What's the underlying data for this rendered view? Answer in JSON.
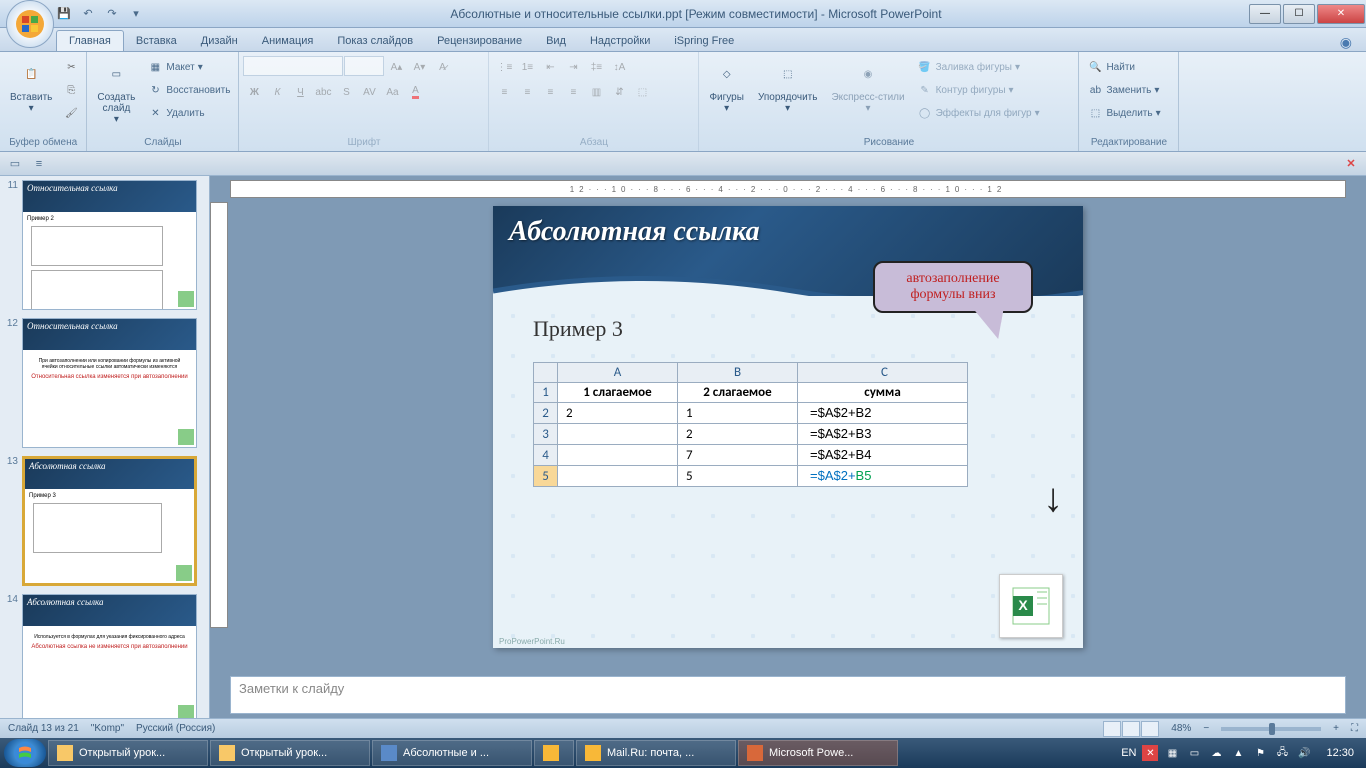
{
  "title": "Абсолютные и относительные ссылки.ppt [Режим совместимости] - Microsoft PowerPoint",
  "tabs": [
    "Главная",
    "Вставка",
    "Дизайн",
    "Анимация",
    "Показ слайдов",
    "Рецензирование",
    "Вид",
    "Надстройки",
    "iSpring Free"
  ],
  "ribbon": {
    "clipboard": {
      "label": "Буфер обмена",
      "paste": "Вставить"
    },
    "slides": {
      "label": "Слайды",
      "new": "Создать\nслайд",
      "layout": "Макет",
      "reset": "Восстановить",
      "delete": "Удалить"
    },
    "font": {
      "label": "Шрифт"
    },
    "paragraph": {
      "label": "Абзац"
    },
    "drawing": {
      "label": "Рисование",
      "shapes": "Фигуры",
      "arrange": "Упорядочить",
      "styles": "Экспресс-стили",
      "fill": "Заливка фигуры",
      "outline": "Контур фигуры",
      "effects": "Эффекты для фигур"
    },
    "editing": {
      "label": "Редактирование",
      "find": "Найти",
      "replace": "Заменить",
      "select": "Выделить"
    }
  },
  "ruler_text": "12···10···8···6···4···2···0···2···4···6···8···10···12",
  "thumbs": [
    {
      "num": "11",
      "title": "Относительная ссылка",
      "sub": "Пример 2"
    },
    {
      "num": "12",
      "title": "Относительная ссылка",
      "txt1": "При автозаполнении или копировании формулы из активной ячейки относительные ссылки автоматически изменяются",
      "red": "Относительная ссылка изменяется при автозаполнении"
    },
    {
      "num": "13",
      "title": "Абсолютная ссылка",
      "sub": "Пример 3"
    },
    {
      "num": "14",
      "title": "Абсолютная ссылка",
      "txt1": "Используется в формулах для указания фиксированного адреса",
      "red": "Абсолютная ссылка не изменяется при автозаполнении"
    }
  ],
  "slide": {
    "title": "Абсолютная ссылка",
    "example": "Пример 3",
    "callout": "автозаполнение формулы вниз",
    "footer": "ProPowerPoint.Ru",
    "table": {
      "cols": [
        "A",
        "B",
        "C"
      ],
      "headers": [
        "1 слагаемое",
        "2 слагаемое",
        "сумма"
      ],
      "rows": [
        {
          "n": "2",
          "a": "2",
          "b": "1",
          "c_ref": "=$A$2+",
          "c_rel": "B2"
        },
        {
          "n": "3",
          "a": "",
          "b": "2",
          "c_ref": "=$A$2+",
          "c_rel": "B3"
        },
        {
          "n": "4",
          "a": "",
          "b": "7",
          "c_ref": "=$A$2+",
          "c_rel": "B4"
        },
        {
          "n": "5",
          "a": "",
          "b": "5",
          "c_ref": "=$A$2+",
          "c_rel": "B5",
          "active": true
        }
      ]
    }
  },
  "notes_placeholder": "Заметки к слайду",
  "status": {
    "slide": "Слайд 13 из 21",
    "theme": "\"Komp\"",
    "lang": "Русский (Россия)",
    "zoom": "48%"
  },
  "taskbar": {
    "items": [
      "Открытый урок...",
      "Открытый урок...",
      "Абсолютные и ...",
      "",
      "Mail.Ru: почта, ...",
      "Microsoft Powe..."
    ],
    "lang": "EN",
    "time": "12:30"
  }
}
